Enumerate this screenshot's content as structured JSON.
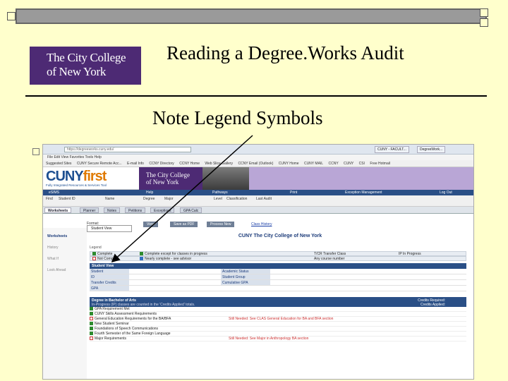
{
  "slide": {
    "title": "Reading a Degree.Works Audit",
    "subtitle": "Note Legend Symbols",
    "logo_line1": "The City College",
    "logo_line2": "of New York"
  },
  "screenshot": {
    "url": "https://degreeworks.cuny.edu/",
    "tab1": "CUNY - FACULT...",
    "tab2": "DegreeWork...",
    "menu": "File  Edit  View  Favorites  Tools  Help",
    "favorites": [
      "Suggested Sites",
      "CUNY Secure Remote Acc...",
      "E-mail Info",
      "CCNY Directory",
      "CCNY Home",
      "Web Slice Gallery",
      "CCNY Email (Outlook)",
      "CUNY Home",
      "CUNY MAIL",
      "CCNY",
      "CUNY",
      "CSI",
      "Free Hotmail"
    ],
    "cuny_brand": "CUNY",
    "cuny_brand_accent": "first",
    "cuny_tagline": "Fully Integrated Resources & Services Tool",
    "ccny_line1": "The City College",
    "ccny_line2": "of New York",
    "nav": [
      "eSIMS",
      "Help",
      "Pathways",
      "Print",
      "Exception Management",
      "Log Out"
    ],
    "student_labels": [
      "Find",
      "Student ID",
      "Name",
      "Degree",
      "Major",
      "Level",
      "Classification",
      "Last Audit"
    ],
    "tabs": [
      "Worksheets",
      "Planner",
      "Notes",
      "Petitions",
      "Exceptions",
      "GPA Calc"
    ],
    "left_nav": [
      "Worksheets",
      "History",
      "What If",
      "Look Ahead"
    ],
    "toolbar": [
      "View",
      "Save as PDF",
      "Process New",
      "Class History"
    ],
    "format_label": "Format:",
    "format_value": "Student View",
    "audit_title": "CUNY The City College of New York",
    "legend_label": "Legend",
    "legend_items": [
      "Complete",
      "Complete except for classes in progress",
      "T/CR Transfer Class",
      "IP In Progress",
      "Not Complete",
      "Nearly complete - see advisor",
      "Any course number"
    ],
    "student_view_head": "Student View",
    "info_rows": [
      {
        "k": "Student",
        "v": "",
        "k2": "Academic Status",
        "v2": ""
      },
      {
        "k": "ID",
        "v": "",
        "k2": "Student Group",
        "v2": ""
      },
      {
        "k": "Transfer Credits",
        "v": "",
        "k2": "Cumulative GPA",
        "v2": ""
      },
      {
        "k": "GPA",
        "v": "",
        "k2": "",
        "v2": ""
      }
    ],
    "degree_head": "Degree in Bachelor of Arts",
    "degree_note": "In-Progress (IP) classes are counted in the 'Credits Applied' totals.",
    "degree_right1": "Credits Required:",
    "degree_right2": "Credits Applied:",
    "req_rows": [
      "GPA Requirement Met",
      "CUNY Skills Assessment Requirements",
      "General Education Requirements for the BA/BFA",
      "New Student Seminar",
      "Foundations of Speech Communications",
      "Fourth Semester of the Same Foreign Language",
      "Major Requirements"
    ],
    "req_note1": "Still Needed: See CLAS General Education for BA and BFA section",
    "req_note2": "Still Needed: See Major in Anthropology BA section"
  }
}
